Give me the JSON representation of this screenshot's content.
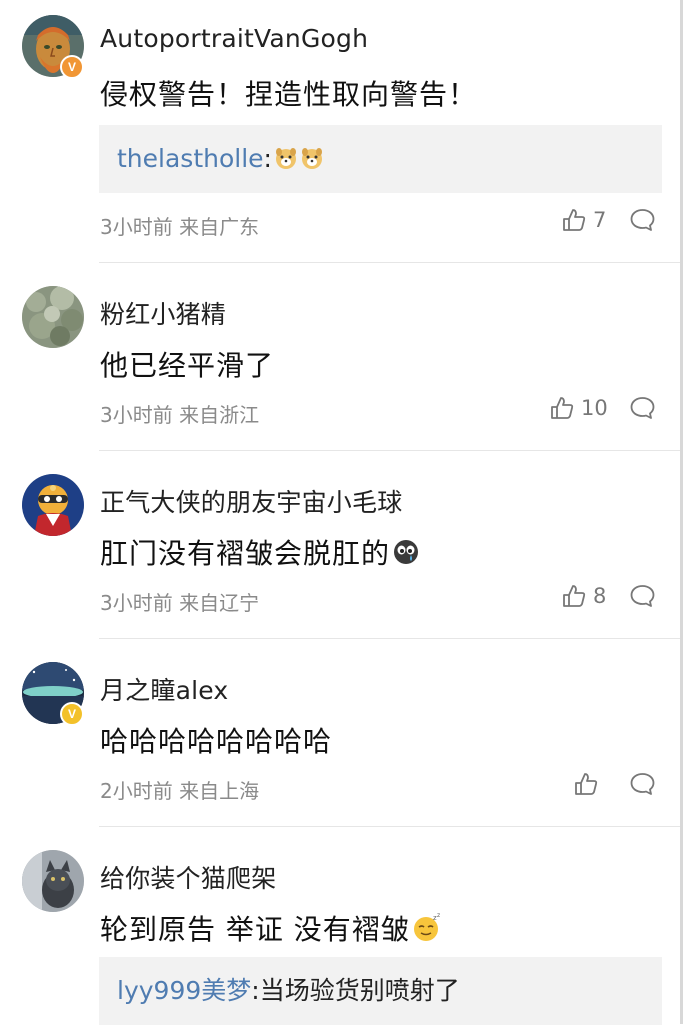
{
  "comments": [
    {
      "user": "AutoportraitVanGogh",
      "badge": "V",
      "text": "侵权警告！捏造性取向警告！",
      "reply": {
        "user": "thelastholle",
        "text": ":"
      },
      "time": "3小时前",
      "location": "来自广东",
      "likes": "7"
    },
    {
      "user": "粉红小猪精",
      "text": "他已经平滑了",
      "time": "3小时前",
      "location": "来自浙江",
      "likes": "10"
    },
    {
      "user": "正气大侠的朋友宇宙小毛球",
      "text": "肛门没有褶皱会脱肛的",
      "time": "3小时前",
      "location": "来自辽宁",
      "likes": "8"
    },
    {
      "user": "月之瞳alex",
      "badge": "V",
      "text": "哈哈哈哈哈哈哈哈",
      "time": "2小时前",
      "location": "来自上海",
      "likes": ""
    },
    {
      "user": "给你装个猫爬架",
      "text": "轮到原告 举证 没有褶皱",
      "reply": {
        "user": "lyy999美梦",
        "text": ":当场验货别喷射了"
      }
    }
  ]
}
